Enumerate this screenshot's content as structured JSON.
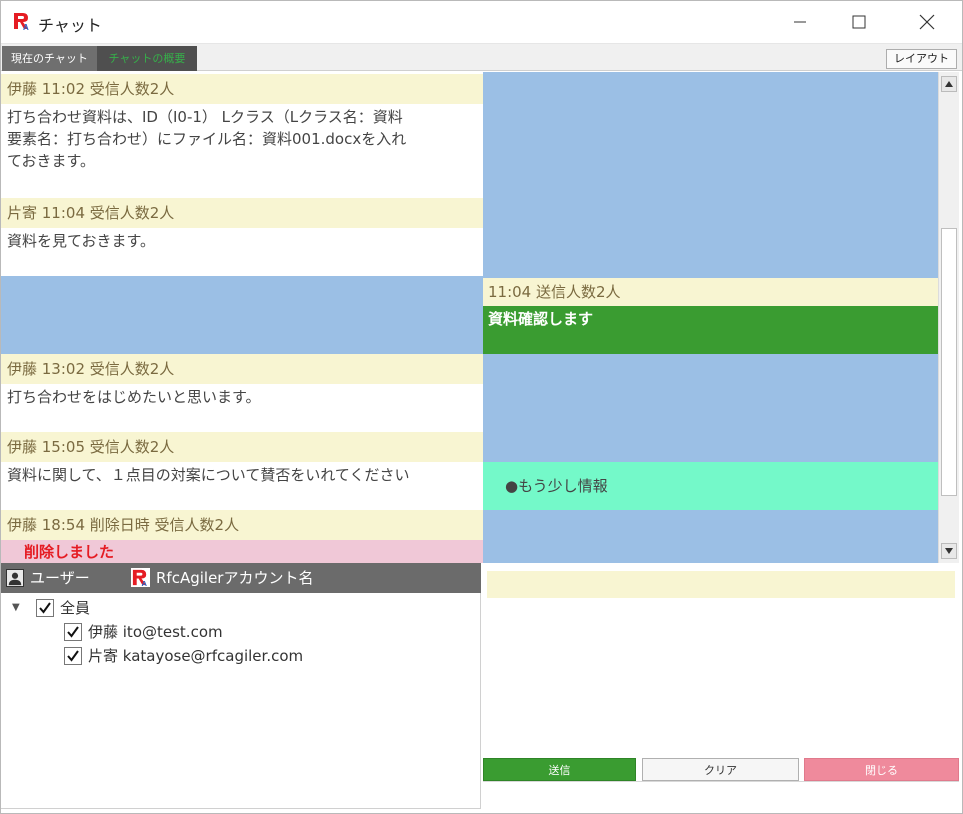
{
  "window": {
    "title": "チャット",
    "minimize_icon": "minimize-icon",
    "maximize_icon": "maximize-icon",
    "close_icon": "close-icon"
  },
  "tabs": [
    {
      "label": "現在のチャット",
      "active": false
    },
    {
      "label": "チャットの概要",
      "active": true
    }
  ],
  "layout_button": "レイアウト",
  "messages_received": [
    {
      "header": "伊藤 11:02 受信人数2人",
      "body": "打ち合わせ資料は、ID（I0-1） Lクラス（Lクラス名：資料\n要素名：打ち合わせ）にファイル名：資料001.docxを入れ\nておきます。"
    },
    {
      "header": "片寄 11:04 受信人数2人",
      "body": "資料を見ておきます。"
    },
    {
      "header": "伊藤 13:02 受信人数2人",
      "body": "打ち合わせをはじめたいと思います。"
    },
    {
      "header": "伊藤 15:05 受信人数2人",
      "body": "資料に関して、１点目の対案について賛否をいれてください"
    },
    {
      "header": "伊藤 18:54 削除日時 受信人数2人",
      "body": "削除しました"
    }
  ],
  "messages_sent": [
    {
      "header": "11:04 送信人数2人",
      "body": "資料確認します"
    }
  ],
  "more_info": "●もう少し情報",
  "users": {
    "header_user": "ユーザー",
    "header_account": "RfcAgilerアカウント名",
    "all_label": "全員",
    "members": [
      {
        "name": "伊藤 ito@test.com",
        "checked": true
      },
      {
        "name": "片寄 katayose@rfcagiler.com",
        "checked": true
      }
    ]
  },
  "buttons": {
    "send": "送信",
    "clear": "クリア",
    "close": "閉じる"
  },
  "colors": {
    "header_bg": "#f8f5d2",
    "chat_blue": "#9bbfe5",
    "sent_green": "#3a9c31",
    "more_info_mint": "#74f9c9",
    "deleted_pink": "#f0c8d7",
    "deleted_text": "#e51c23",
    "close_button": "#ef8a9c"
  }
}
